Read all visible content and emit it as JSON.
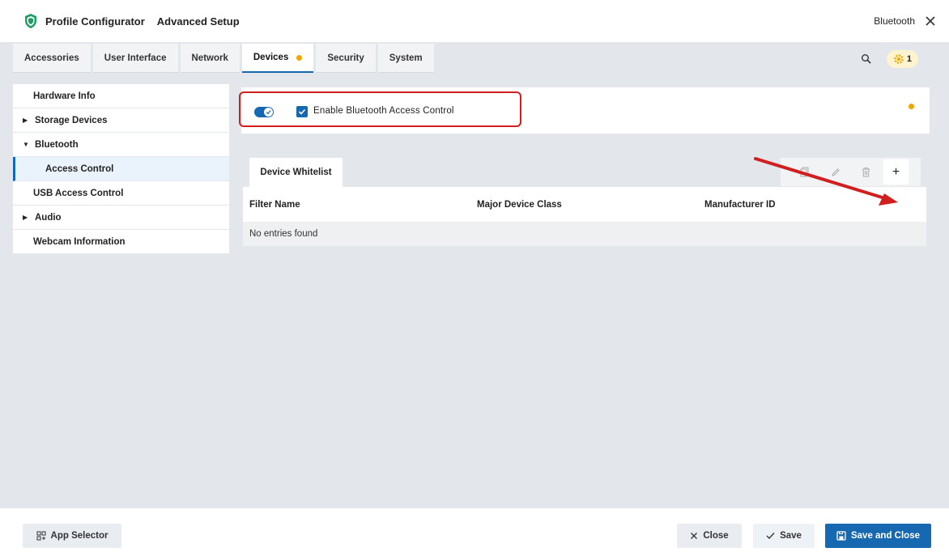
{
  "header": {
    "app_title": "Profile Configurator",
    "subtitle": "Advanced Setup",
    "context_label": "Bluetooth"
  },
  "tabs": [
    {
      "label": "Accessories"
    },
    {
      "label": "User Interface"
    },
    {
      "label": "Network"
    },
    {
      "label": "Devices",
      "active": true,
      "modified": true
    },
    {
      "label": "Security"
    },
    {
      "label": "System"
    }
  ],
  "notifications": {
    "count": "1"
  },
  "sidebar": {
    "items": [
      {
        "label": "Hardware Info"
      },
      {
        "label": "Storage Devices",
        "caret": "collapsed"
      },
      {
        "label": "Bluetooth",
        "caret": "expanded"
      },
      {
        "label": "Access Control",
        "selected": true
      },
      {
        "label": "USB Access Control"
      },
      {
        "label": "Audio",
        "caret": "collapsed"
      },
      {
        "label": "Webcam Information"
      }
    ]
  },
  "bluetooth_control": {
    "toggle_on": true,
    "checked": true,
    "label": "Enable Bluetooth Access Control"
  },
  "whitelist": {
    "tab_label": "Device Whitelist",
    "columns": [
      "Filter Name",
      "Major Device Class",
      "Manufacturer ID"
    ],
    "empty_text": "No entries found",
    "add_symbol": "+"
  },
  "footer": {
    "app_selector": "App Selector",
    "close": "Close",
    "save": "Save",
    "save_and_close": "Save and Close"
  },
  "colors": {
    "accent": "#1669b0",
    "modified_dot": "#f0a500",
    "highlight": "#d11f1f",
    "workspace": "#e3e6ea"
  }
}
